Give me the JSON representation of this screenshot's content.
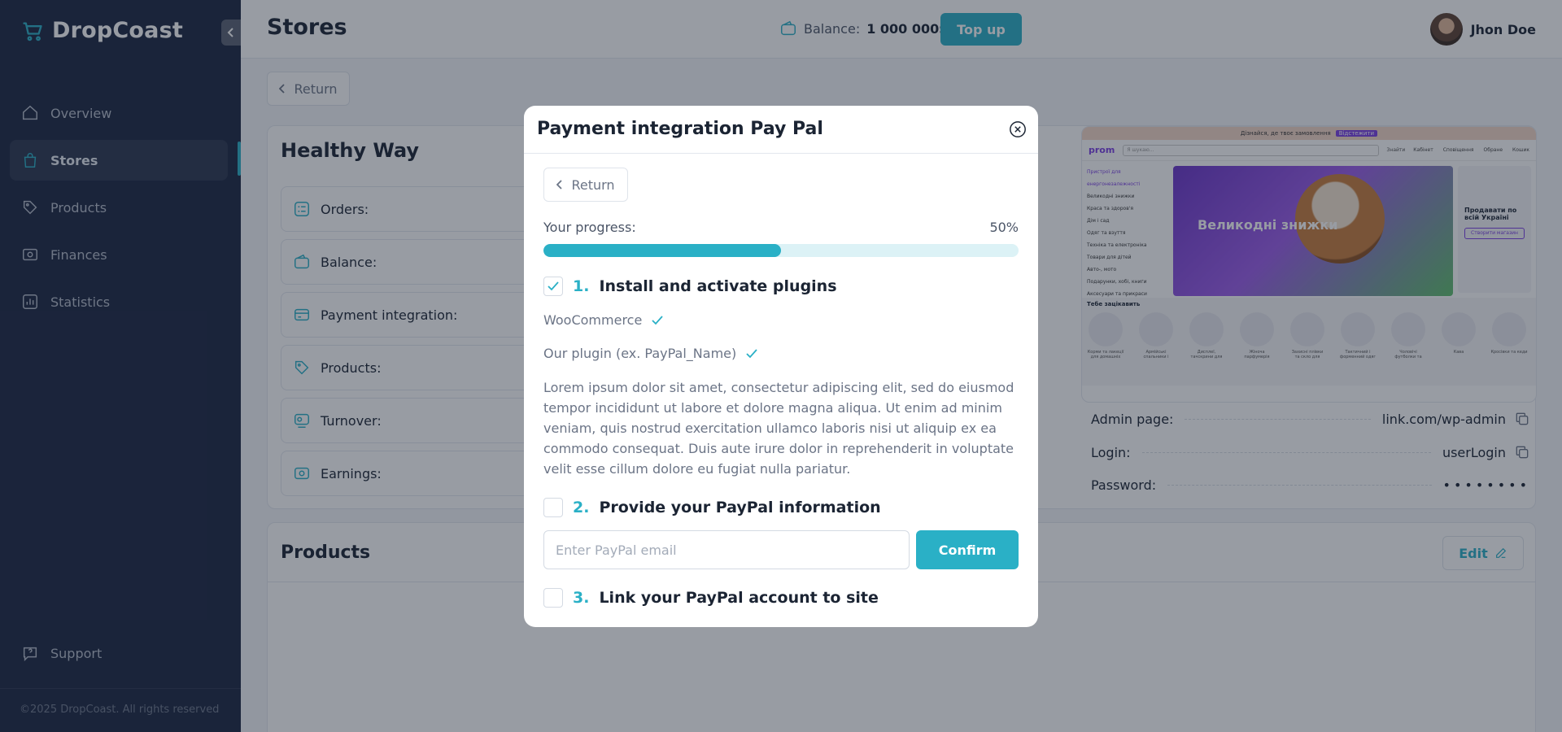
{
  "app": {
    "brand": "DropCoast",
    "copyright": "©2025 DropCoast. All rights reserved"
  },
  "sidebar": {
    "items": [
      {
        "label": "Overview",
        "icon": "home-icon"
      },
      {
        "label": "Stores",
        "icon": "bag-icon"
      },
      {
        "label": "Products",
        "icon": "tag-icon"
      },
      {
        "label": "Finances",
        "icon": "cash-icon"
      },
      {
        "label": "Statistics",
        "icon": "chart-icon"
      }
    ],
    "active": "Stores",
    "support_label": "Support"
  },
  "header": {
    "title": "Stores",
    "balance_label": "Balance:",
    "balance_value": "1 000 000$",
    "topup_label": "Top up",
    "user_name": "Jhon Doe"
  },
  "page": {
    "return_label": "Return",
    "store_name": "Healthy Way",
    "stats": [
      {
        "label": "Orders:"
      },
      {
        "label": "Balance:"
      },
      {
        "label": "Payment integration:"
      },
      {
        "label": "Products:"
      },
      {
        "label": "Turnover:"
      },
      {
        "label": "Earnings:"
      }
    ],
    "preview": {
      "promo_text": "Дізнайся, де твоє замовлення",
      "promo_tag": "Відстежити",
      "logo": "prom",
      "search_placeholder": "Я шукаю...",
      "search_btn": "Знайти",
      "nav_icons": [
        "Кабінет",
        "Сповіщення",
        "Обране",
        "Кошик"
      ],
      "menu": [
        "Пристрої для енергонезалежності",
        "Великодні знижки",
        "Краса та здоров'я",
        "Дім і сад",
        "Одяг та взуття",
        "Техніка та електроніка",
        "Товари для дітей",
        "Авто-, мото",
        "Подарунки, хобі, книги",
        "Аксесуари та прикраси"
      ],
      "banner_text": "Великодні знижки",
      "side_title": "Продавати по всій Україні",
      "side_button": "Створити магазин",
      "recs_title": "Тебе зацікавить",
      "recs": [
        "Корми та лакеції для домашніх",
        "Армійські спальники і",
        "Дисплеї, тачскрини для",
        "Жіноча парфумерія",
        "Захисні плівки та скло для",
        "Тактичний і форменний одяг",
        "Чоловічі футболки та",
        "Кава",
        "Кросівки та кеди"
      ]
    },
    "admin": {
      "admin_label": "Admin page:",
      "admin_value": "link.com/wp-admin",
      "login_label": "Login:",
      "login_value": "userLogin",
      "password_label": "Password:",
      "password_value": "••••••••"
    },
    "products_title": "Products",
    "edit_label": "Edit"
  },
  "modal": {
    "title": "Payment integration Pay Pal",
    "return_label": "Return",
    "progress_label": "Your progress:",
    "progress_text": "50%",
    "progress_value": 0.5,
    "step1": {
      "num": "1.",
      "title": "Install and activate plugins",
      "checked": true
    },
    "plugins": [
      "WooCommerce",
      "Our plugin (ex. PayPal_Name)"
    ],
    "description": "Lorem ipsum dolor sit amet, consectetur adipiscing elit, sed do eiusmod tempor incididunt ut labore et dolore magna aliqua. Ut enim ad minim veniam, quis nostrud exercitation ullamco laboris nisi ut aliquip ex ea commodo consequat. Duis aute irure dolor in reprehenderit in voluptate velit esse cillum dolore eu fugiat nulla pariatur.",
    "step2": {
      "num": "2.",
      "title": "Provide your PayPal information",
      "checked": false
    },
    "email_placeholder": "Enter PayPal email",
    "confirm_label": "Confirm",
    "step3": {
      "num": "3.",
      "title": "Link your PayPal account to site",
      "checked": false
    }
  },
  "colors": {
    "accent": "#2ab0c6",
    "sidebar_bg": "#1b2540",
    "text_dark": "#1b2433",
    "text_muted": "#6b7486"
  }
}
